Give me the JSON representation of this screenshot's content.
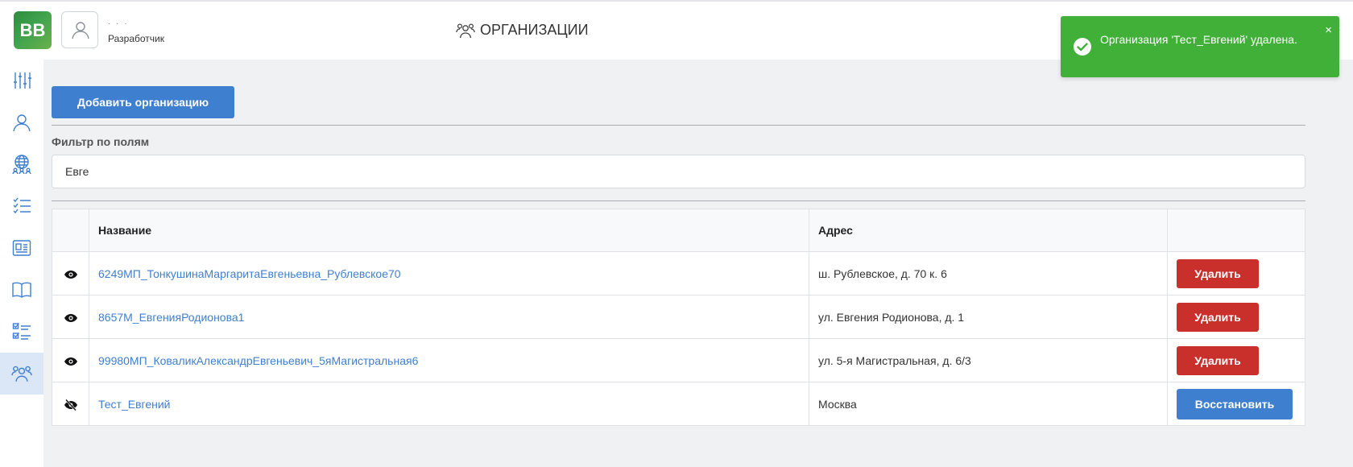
{
  "app": {
    "logo_text": "BB"
  },
  "user": {
    "name_masked": "· · ·",
    "role": "Разработчик"
  },
  "header": {
    "title": "ОРГАНИЗАЦИИ",
    "title_icon": "users-group-icon"
  },
  "sidebar": {
    "items": [
      {
        "icon": "sliders-icon"
      },
      {
        "icon": "user-icon"
      },
      {
        "icon": "globe-people-icon"
      },
      {
        "icon": "checklist-icon"
      },
      {
        "icon": "id-card-icon"
      },
      {
        "icon": "book-icon"
      },
      {
        "icon": "task-list-icon"
      },
      {
        "icon": "users-group-icon",
        "active": true
      }
    ]
  },
  "toolbar": {
    "add_label": "Добавить организацию"
  },
  "filter": {
    "label": "Фильтр по полям",
    "value": "Евге"
  },
  "table": {
    "headers": {
      "name": "Название",
      "address": "Адрес"
    },
    "rows": [
      {
        "visible": true,
        "name": "6249МП_ТонкушинаМаргаритаЕвгеньевна_Рублевское70",
        "address": "ш. Рублевское, д. 70 к. 6",
        "action": "Удалить",
        "action_type": "delete"
      },
      {
        "visible": true,
        "name": "8657М_ЕвгенияРодионова1",
        "address": "ул. Евгения Родионова, д. 1",
        "action": "Удалить",
        "action_type": "delete"
      },
      {
        "visible": true,
        "name": "99980МП_КоваликАлександрЕвгеньевич_5яМагистральная6",
        "address": "ул. 5-я Магистральная, д. 6/3",
        "action": "Удалить",
        "action_type": "delete"
      },
      {
        "visible": false,
        "name": "Тест_Евгений",
        "address": "Москва",
        "action": "Восстановить",
        "action_type": "restore"
      }
    ]
  },
  "toast": {
    "message": "Организация 'Тест_Евгений' удалена.",
    "close": "×",
    "color": "#41b038"
  },
  "colors": {
    "primary": "#3f7fcf",
    "danger": "#c9302c",
    "success": "#41b038",
    "active_bg": "#dbe6f7"
  }
}
